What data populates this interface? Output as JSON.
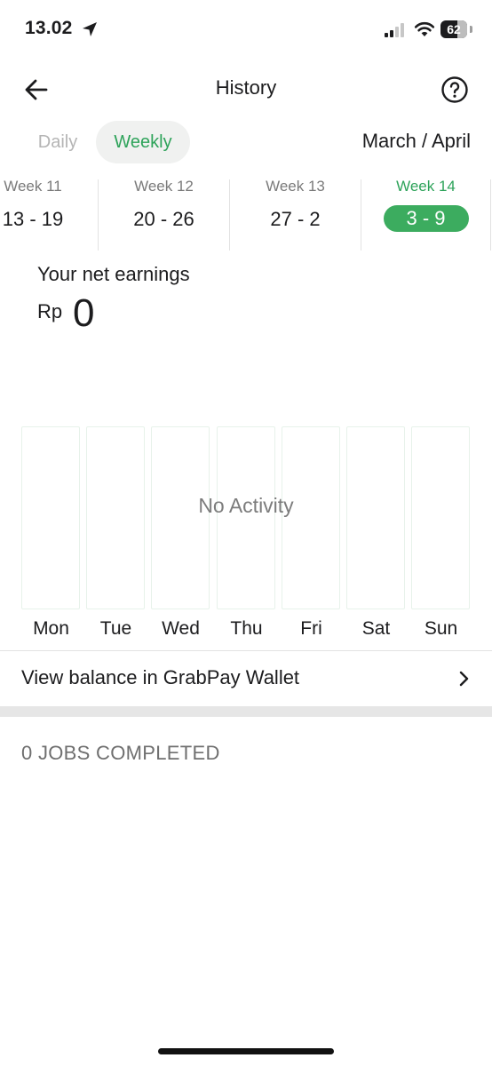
{
  "status_bar": {
    "time": "13.02",
    "battery_text": "62",
    "battery_level": 0.62
  },
  "header": {
    "title": "History",
    "back_icon": "arrow-left-icon",
    "help_icon": "question-circle-icon"
  },
  "toggle": {
    "daily": "Daily",
    "weekly": "Weekly",
    "selected": "Weekly"
  },
  "month_label": "March / April",
  "weeks": [
    {
      "label": "Week 11",
      "range": "13 - 19"
    },
    {
      "label": "Week 12",
      "range": "20 - 26"
    },
    {
      "label": "Week 13",
      "range": "27 - 2"
    },
    {
      "label": "Week 14",
      "range": "3 - 9",
      "selected": true
    }
  ],
  "earnings": {
    "label": "Your net earnings",
    "currency": "Rp",
    "value": "0"
  },
  "chart": {
    "empty_text": "No Activity",
    "days": [
      "Mon",
      "Tue",
      "Wed",
      "Thu",
      "Fri",
      "Sat",
      "Sun"
    ],
    "values": [
      0,
      0,
      0,
      0,
      0,
      0,
      0
    ]
  },
  "wallet_row": {
    "label": "View balance in GrabPay Wallet",
    "chevron_icon": "chevron-right-icon"
  },
  "jobs_completed": "0 JOBS COMPLETED",
  "colors": {
    "accent": "#2ea35a",
    "selected_pill": "#3cac5f"
  }
}
